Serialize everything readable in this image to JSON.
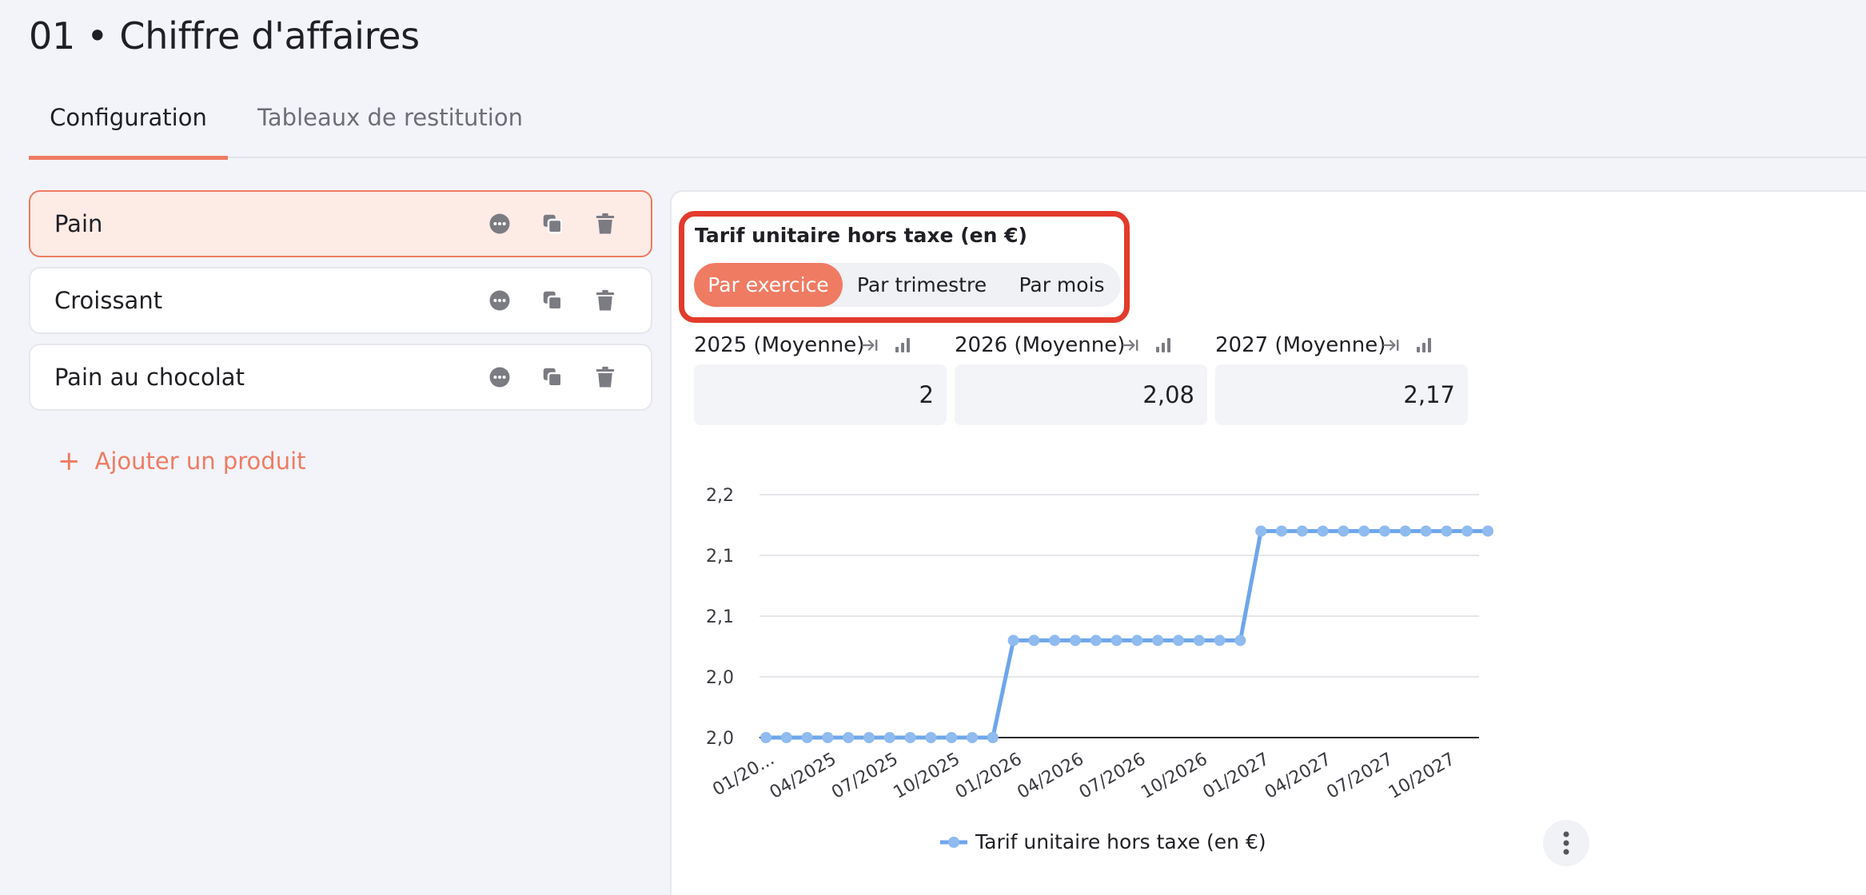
{
  "page": {
    "title": "01 • Chiffre d'affaires"
  },
  "tabs": [
    {
      "label": "Configuration",
      "active": true
    },
    {
      "label": "Tableaux de restitution",
      "active": false
    }
  ],
  "products": [
    {
      "name": "Pain",
      "selected": true
    },
    {
      "name": "Croissant",
      "selected": false
    },
    {
      "name": "Pain au chocolat",
      "selected": false
    }
  ],
  "add_product": {
    "plus": "+",
    "label": "Ajouter un produit"
  },
  "config": {
    "section_label": "Tarif unitaire hors taxe (en €)",
    "periods": [
      "Par exercice",
      "Par trimestre",
      "Par mois"
    ],
    "active_period": "Par exercice",
    "years": [
      {
        "label": "2025 (Moyenne)",
        "value": "2"
      },
      {
        "label": "2026 (Moyenne)",
        "value": "2,08"
      },
      {
        "label": "2027 (Moyenne)",
        "value": "2,17"
      }
    ]
  },
  "colors": {
    "accent": "#ef7b63",
    "highlight": "#e33a2c",
    "series": "#6ea6ea"
  },
  "chart_data": {
    "type": "line",
    "x": [
      "01/2025",
      "02/2025",
      "03/2025",
      "04/2025",
      "05/2025",
      "06/2025",
      "07/2025",
      "08/2025",
      "09/2025",
      "10/2025",
      "11/2025",
      "12/2025",
      "01/2026",
      "02/2026",
      "03/2026",
      "04/2026",
      "05/2026",
      "06/2026",
      "07/2026",
      "08/2026",
      "09/2026",
      "10/2026",
      "11/2026",
      "12/2026",
      "01/2027",
      "02/2027",
      "03/2027",
      "04/2027",
      "05/2027",
      "06/2027",
      "07/2027",
      "08/2027",
      "09/2027",
      "10/2027",
      "11/2027",
      "12/2027"
    ],
    "x_tick_labels": [
      "01/20...",
      "04/2025",
      "07/2025",
      "10/2025",
      "01/2026",
      "04/2026",
      "07/2026",
      "10/2026",
      "01/2027",
      "04/2027",
      "07/2027",
      "10/2027"
    ],
    "series": [
      {
        "name": "Tarif unitaire hors taxe (en €)",
        "values": [
          2,
          2,
          2,
          2,
          2,
          2,
          2,
          2,
          2,
          2,
          2,
          2,
          2.08,
          2.08,
          2.08,
          2.08,
          2.08,
          2.08,
          2.08,
          2.08,
          2.08,
          2.08,
          2.08,
          2.08,
          2.17,
          2.17,
          2.17,
          2.17,
          2.17,
          2.17,
          2.17,
          2.17,
          2.17,
          2.17,
          2.17,
          2.17
        ]
      }
    ],
    "y_ticks": [
      2.0,
      2.05,
      2.1,
      2.15,
      2.2
    ],
    "y_tick_labels": [
      "2,0",
      "2,0",
      "2,1",
      "2,1",
      "2,2"
    ],
    "ylim": [
      2.0,
      2.2
    ],
    "grid": true,
    "legend": "bottom",
    "title": "",
    "xlabel": "",
    "ylabel": ""
  }
}
